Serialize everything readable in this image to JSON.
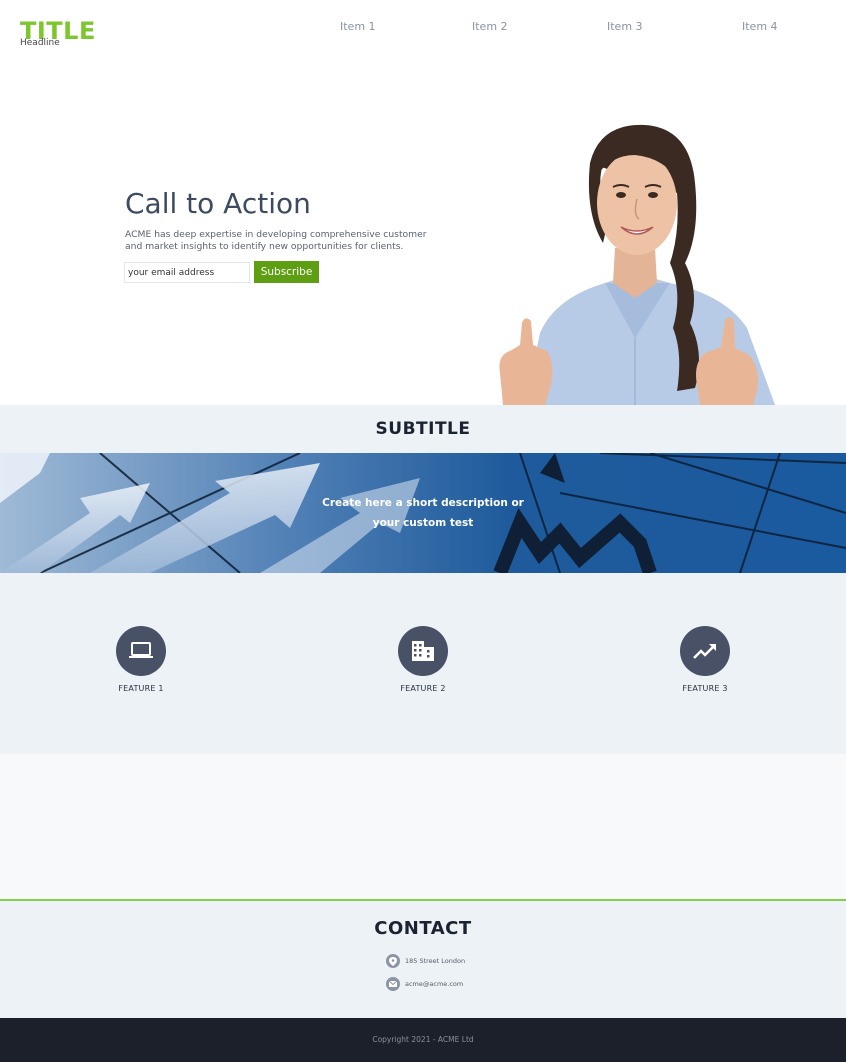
{
  "header": {
    "logo_title": "TITLE",
    "logo_headline": "Headline",
    "nav": [
      "Item 1",
      "Item 2",
      "Item 3",
      "Item 4"
    ]
  },
  "hero": {
    "title": "Call to Action",
    "text": "ACME has deep expertise in developing comprehensive customer and market insights to identify new opportunities for clients.",
    "email_placeholder": "your email address",
    "subscribe_label": "Subscribe"
  },
  "subtitle": "SUBTITLE",
  "banner": {
    "line1": "Create here a short description or",
    "line2": "your custom test"
  },
  "features": [
    {
      "label": "FEATURE 1",
      "icon": "laptop-icon"
    },
    {
      "label": "FEATURE 2",
      "icon": "building-icon"
    },
    {
      "label": "FEATURE 3",
      "icon": "trending-up-icon"
    }
  ],
  "contact": {
    "title": "CONTACT",
    "address": "185 Street London",
    "email": "acme@acme.com"
  },
  "footer": {
    "copyright": "Copyright 2021 - ACME Ltd"
  },
  "colors": {
    "brand_green": "#7cc72e",
    "button_green": "#5e9e12",
    "feature_circle": "#485166",
    "footer_bg": "#1c202b",
    "section_bg": "#edf2f7"
  }
}
